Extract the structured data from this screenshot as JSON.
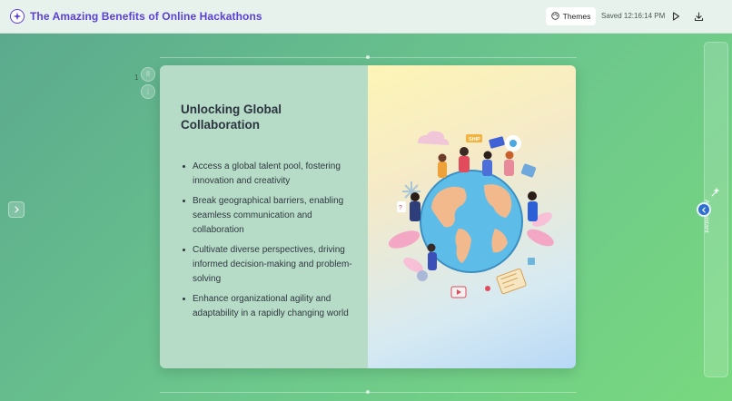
{
  "header": {
    "title": "The Amazing Benefits of Online Hackathons",
    "themes_label": "Themes",
    "saved_text": "Saved 12:16:14 PM"
  },
  "editor": {
    "slide_number": "1"
  },
  "slide": {
    "heading": "Unlocking Global Collaboration",
    "bullets": [
      "Access a global talent pool, fostering innovation and creativity",
      "Break geographical barriers, enabling seamless communication and collaboration",
      "Cultivate diverse perspectives, driving informed decision-making and problem-solving",
      "Enhance organizational agility and adaptability in a rapidly changing world"
    ],
    "illustration_badge": "SHIP"
  },
  "assistant": {
    "label": "AI Assistant"
  },
  "colors": {
    "brand": "#5b3fd6",
    "background_start": "#5aa88e",
    "background_end": "#78d87f",
    "slide_left_bg": "#b6dcc7",
    "accent_blue": "#2f6fd0"
  },
  "icons": {
    "logo": "sparkle-logo-icon",
    "themes": "palette-icon",
    "present": "play-icon",
    "download": "download-icon",
    "next": "chevron-right-icon",
    "collapse": "chevron-left-icon",
    "assistant": "magic-wand-icon"
  }
}
